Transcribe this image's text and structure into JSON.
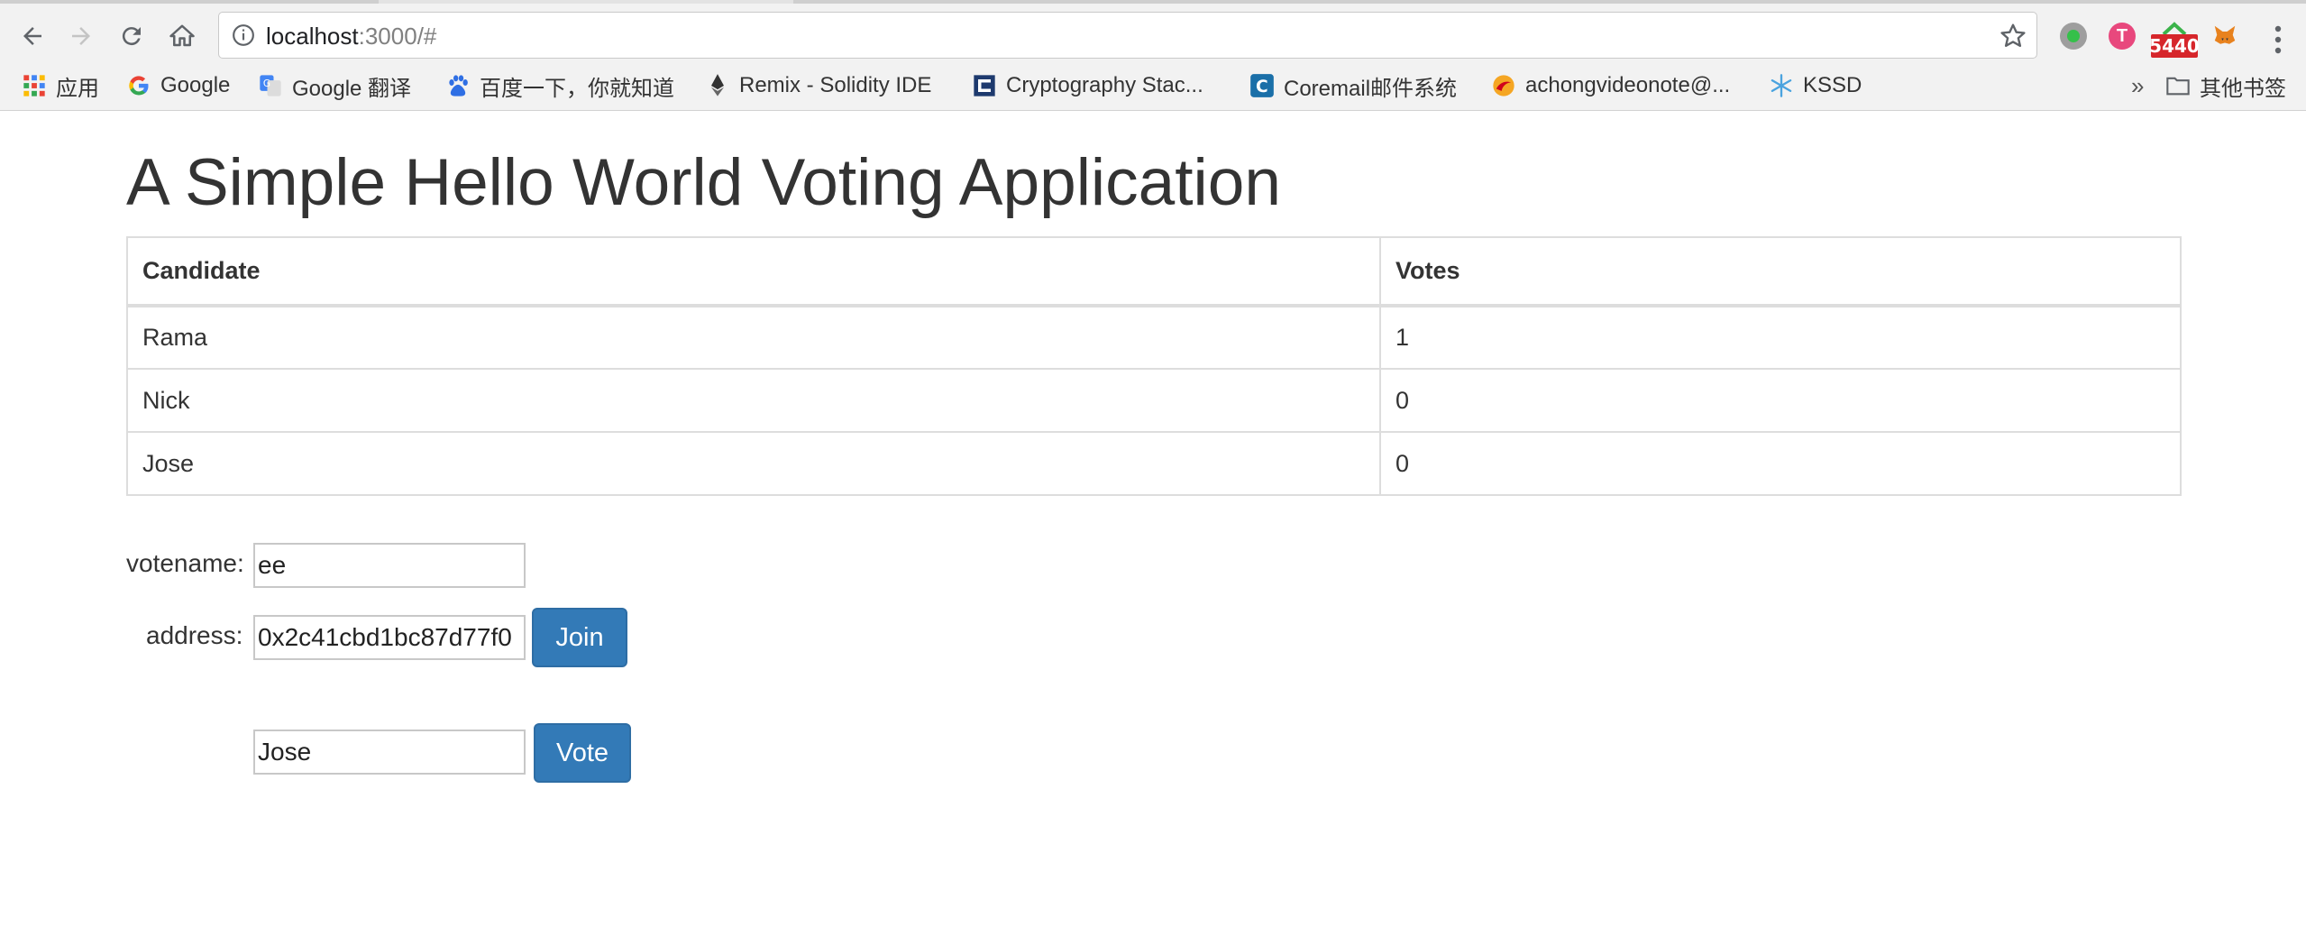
{
  "browser": {
    "url_host": "localhost",
    "url_rest": ":3000/#",
    "extension_badge": "5440",
    "ext_pink_letter": "T",
    "bookmarks": [
      {
        "label": "应用",
        "icon": "apps-grid-icon"
      },
      {
        "label": "Google",
        "icon": "google-icon"
      },
      {
        "label": "Google 翻译",
        "icon": "google-translate-icon"
      },
      {
        "label": "百度一下，你就知道",
        "icon": "baidu-paw-icon"
      },
      {
        "label": "Remix - Solidity IDE",
        "icon": "remix-ethereum-icon"
      },
      {
        "label": "Cryptography Stac...",
        "icon": "stackexchange-icon"
      },
      {
        "label": "Coremail邮件系统",
        "icon": "coremail-icon"
      },
      {
        "label": "achongvideonote@...",
        "icon": "mail-icon"
      },
      {
        "label": "KSSD",
        "icon": "snowflake-icon"
      }
    ],
    "more_bookmarks_label": "其他书签",
    "more_chevron": "»"
  },
  "page": {
    "title": "A Simple Hello World Voting Application",
    "table": {
      "headers": [
        "Candidate",
        "Votes"
      ],
      "rows": [
        [
          "Rama",
          "1"
        ],
        [
          "Nick",
          "0"
        ],
        [
          "Jose",
          "0"
        ]
      ]
    },
    "form": {
      "votename_label": "votename:",
      "votename_value": "ee",
      "address_label": "address:",
      "address_value": "0x2c41cbd1bc87d77f0",
      "join_label": "Join",
      "candidate_value": "Jose",
      "vote_label": "Vote"
    }
  },
  "colors": {
    "primary_button": "#337ab7",
    "table_border": "#dddddd",
    "text": "#333333"
  }
}
